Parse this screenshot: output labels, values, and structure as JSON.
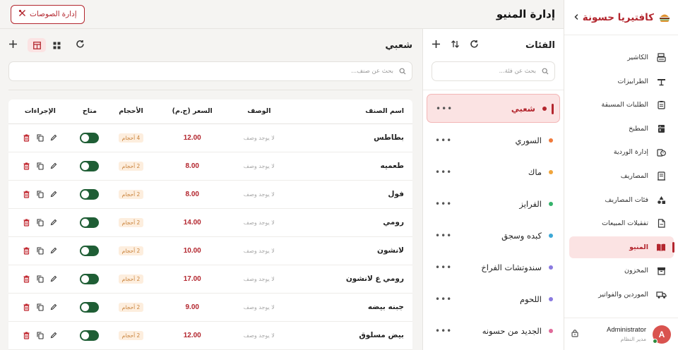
{
  "brand": {
    "name": "كافتيريا حسونة",
    "collapse_icon": "chevron-left-icon"
  },
  "sidebar": {
    "items": [
      {
        "label": "الكاشير",
        "icon": "cash-register-icon",
        "active": false
      },
      {
        "label": "الطرابيزات",
        "icon": "table-icon",
        "active": false
      },
      {
        "label": "الطلبات المسبقة",
        "icon": "clipboard-icon",
        "active": false
      },
      {
        "label": "المطبخ",
        "icon": "kitchen-icon",
        "active": false
      },
      {
        "label": "إدارة الوردية",
        "icon": "shift-icon",
        "active": false
      },
      {
        "label": "المصاريف",
        "icon": "expenses-icon",
        "active": false
      },
      {
        "label": "فئات المصاريف",
        "icon": "shapes-icon",
        "active": false
      },
      {
        "label": "تفقيلات المبيعات",
        "icon": "report-icon",
        "active": false
      },
      {
        "label": "المنيو",
        "icon": "menu-book-icon",
        "active": true
      },
      {
        "label": "المخزون",
        "icon": "archive-icon",
        "active": false
      },
      {
        "label": "الموردين والفواتير",
        "icon": "truck-icon",
        "active": false
      }
    ]
  },
  "user": {
    "initial": "A",
    "name": "Administrator",
    "role": "مدير النظام"
  },
  "header": {
    "title": "إدارة المنيو",
    "manage_sauces_label": "إدارة الصوصات"
  },
  "categories_panel": {
    "title": "الفئات",
    "search_placeholder": "بحث عن فئة...",
    "items": [
      {
        "name": "شعبي",
        "dot_color": "#b3262e",
        "active": true
      },
      {
        "name": "السوري",
        "dot_color": "#f07a3c",
        "active": false
      },
      {
        "name": "ماك",
        "dot_color": "#f0a53c",
        "active": false
      },
      {
        "name": "الفرايز",
        "dot_color": "#35b36b",
        "active": false
      },
      {
        "name": "كبده وسجق",
        "dot_color": "#3ca8d6",
        "active": false
      },
      {
        "name": "سندوتشات الفراخ",
        "dot_color": "#8a7ae0",
        "active": false
      },
      {
        "name": "اللحوم",
        "dot_color": "#8a7ae0",
        "active": false
      },
      {
        "name": "الجديد من حسونه",
        "dot_color": "#e06a9a",
        "active": false
      }
    ]
  },
  "items_panel": {
    "title": "شعبي",
    "search_placeholder": "بحث عن صنف...",
    "columns": {
      "name": "اسم الصنف",
      "description": "الوصف",
      "price": "السعر (ج.م)",
      "sizes": "الأحجام",
      "available": "متاح",
      "actions": "الإجراءات"
    },
    "rows": [
      {
        "name": "بطاطس",
        "description": "لا يوجد وصف",
        "price": "12.00",
        "sizes": "4 أحجام",
        "available": true
      },
      {
        "name": "طعميه",
        "description": "لا يوجد وصف",
        "price": "8.00",
        "sizes": "2 أحجام",
        "available": true
      },
      {
        "name": "فول",
        "description": "لا يوجد وصف",
        "price": "8.00",
        "sizes": "2 أحجام",
        "available": true
      },
      {
        "name": "رومي",
        "description": "لا يوجد وصف",
        "price": "14.00",
        "sizes": "2 أحجام",
        "available": true
      },
      {
        "name": "لانشون",
        "description": "لا يوجد وصف",
        "price": "10.00",
        "sizes": "2 أحجام",
        "available": true
      },
      {
        "name": "رومي ع لانشون",
        "description": "لا يوجد وصف",
        "price": "17.00",
        "sizes": "2 أحجام",
        "available": true
      },
      {
        "name": "جبنه بيضه",
        "description": "لا يوجد وصف",
        "price": "9.00",
        "sizes": "2 أحجام",
        "available": true
      },
      {
        "name": "بيض مسلوق",
        "description": "لا يوجد وصف",
        "price": "12.00",
        "sizes": "2 أحجام",
        "available": true
      }
    ]
  },
  "colors": {
    "accent": "#b3262e",
    "accent_soft": "#fbe3e3",
    "toggle_on": "#1f5e35"
  }
}
